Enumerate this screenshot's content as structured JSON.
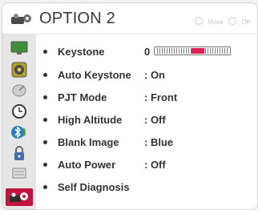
{
  "header": {
    "title": "OPTION 2",
    "hint_move": "Move",
    "hint_ok": "OK"
  },
  "sidebar": {
    "items": [
      {
        "icon": "picture-icon"
      },
      {
        "icon": "speaker-icon"
      },
      {
        "icon": "satellite-dish-icon"
      },
      {
        "icon": "clock-icon"
      },
      {
        "icon": "bluetooth-icon"
      },
      {
        "icon": "lock-icon"
      },
      {
        "icon": "option-icon"
      },
      {
        "icon": "option-gears-icon",
        "active": true
      }
    ]
  },
  "menu": {
    "items": [
      {
        "label": "Keystone",
        "value": "0",
        "slider_level": 0
      },
      {
        "label": "Auto Keystone",
        "value": ": On"
      },
      {
        "label": "PJT Mode",
        "value": ": Front"
      },
      {
        "label": "High Altitude",
        "value": ": Off"
      },
      {
        "label": "Blank Image",
        "value": ": Blue"
      },
      {
        "label": "Auto Power",
        "value": ": Off"
      },
      {
        "label": "Self Diagnosis",
        "value": ""
      }
    ]
  },
  "colors": {
    "accent": "#c4133f",
    "sidebar_bg": "#e6e6e6",
    "text": "#333333"
  }
}
